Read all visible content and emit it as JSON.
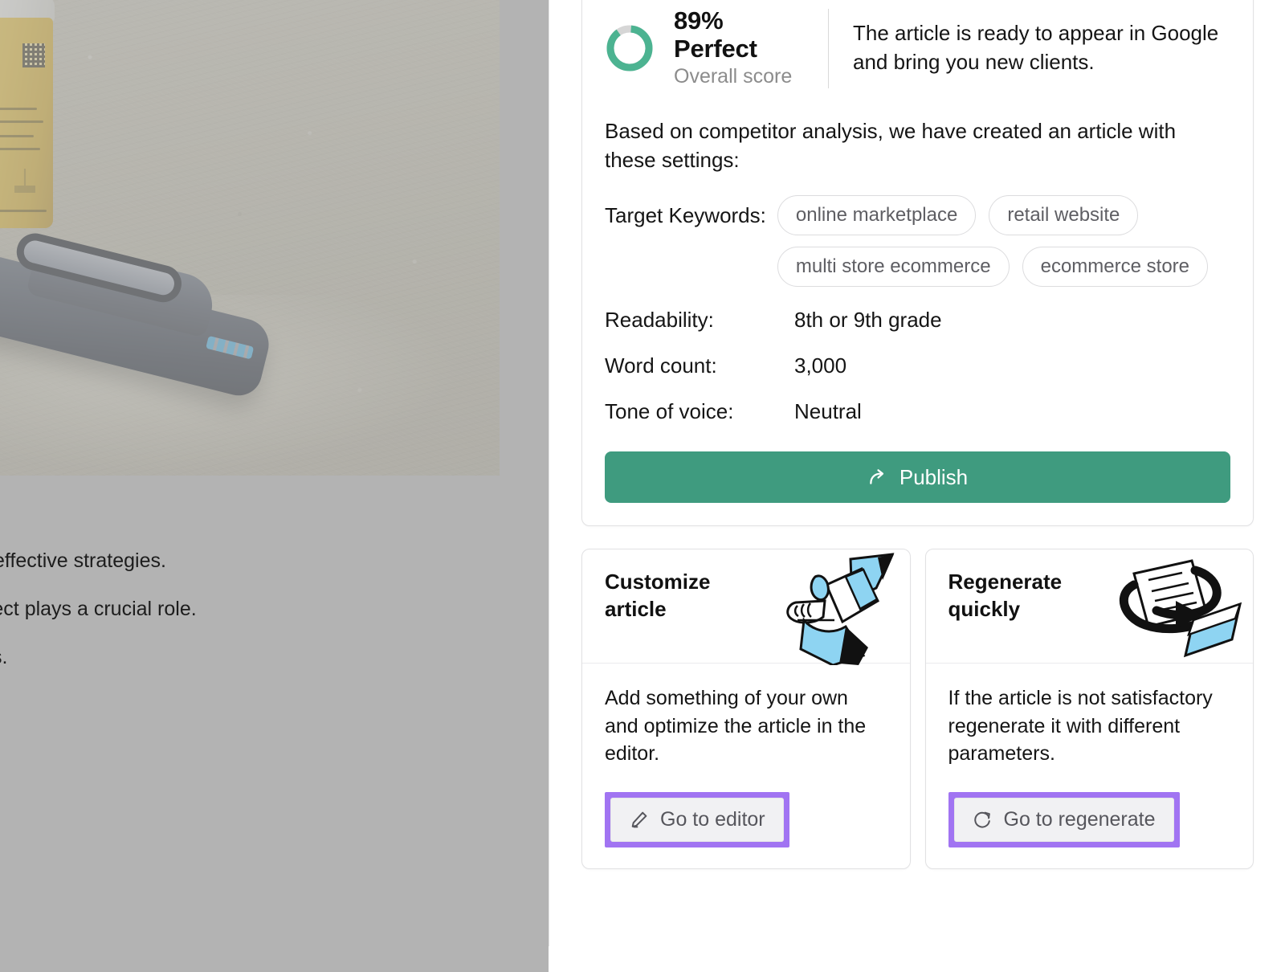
{
  "background": {
    "photo_alt": "blood-glucose-test-strip-vial-and-lancing-device-on-concrete",
    "text_fragments": [
      "effective strategies.",
      "spect plays a crucial role.",
      "s."
    ]
  },
  "panel": {
    "score": {
      "percent": 89,
      "title": "89% Perfect",
      "subtitle": "Overall score",
      "description": "The article is ready to appear in Google and bring you new clients.",
      "ring_color": "#4cb391",
      "ring_track_color": "#d6d6d6"
    },
    "intro": "Based on competitor analysis, we have created an article with these settings:",
    "keywords": {
      "label": "Target Keywords:",
      "items": [
        "online marketplace",
        "retail website",
        "multi store ecommerce",
        "ecommerce store"
      ]
    },
    "specs": [
      {
        "key": "Readability:",
        "value": "8th or 9th grade"
      },
      {
        "key": "Word count:",
        "value": "3,000"
      },
      {
        "key": "Tone of voice:",
        "value": "Neutral"
      }
    ],
    "publish": {
      "label": "Publish",
      "icon": "share-arrow-icon",
      "color": "#3f9b7f"
    },
    "cards": [
      {
        "title": "Customize article",
        "art": "hand-holding-pencil-illustration",
        "description": "Add something of your own and optimize the article in the editor.",
        "cta_label": "Go to editor",
        "cta_icon": "pencil-icon",
        "highlight_color": "#a174f2"
      },
      {
        "title": "Regenerate quickly",
        "art": "documents-refresh-illustration",
        "description": "If the article is not satisfactory regenerate it with different parameters.",
        "cta_label": "Go to regenerate",
        "cta_icon": "refresh-icon",
        "highlight_color": "#a174f2"
      }
    ]
  }
}
